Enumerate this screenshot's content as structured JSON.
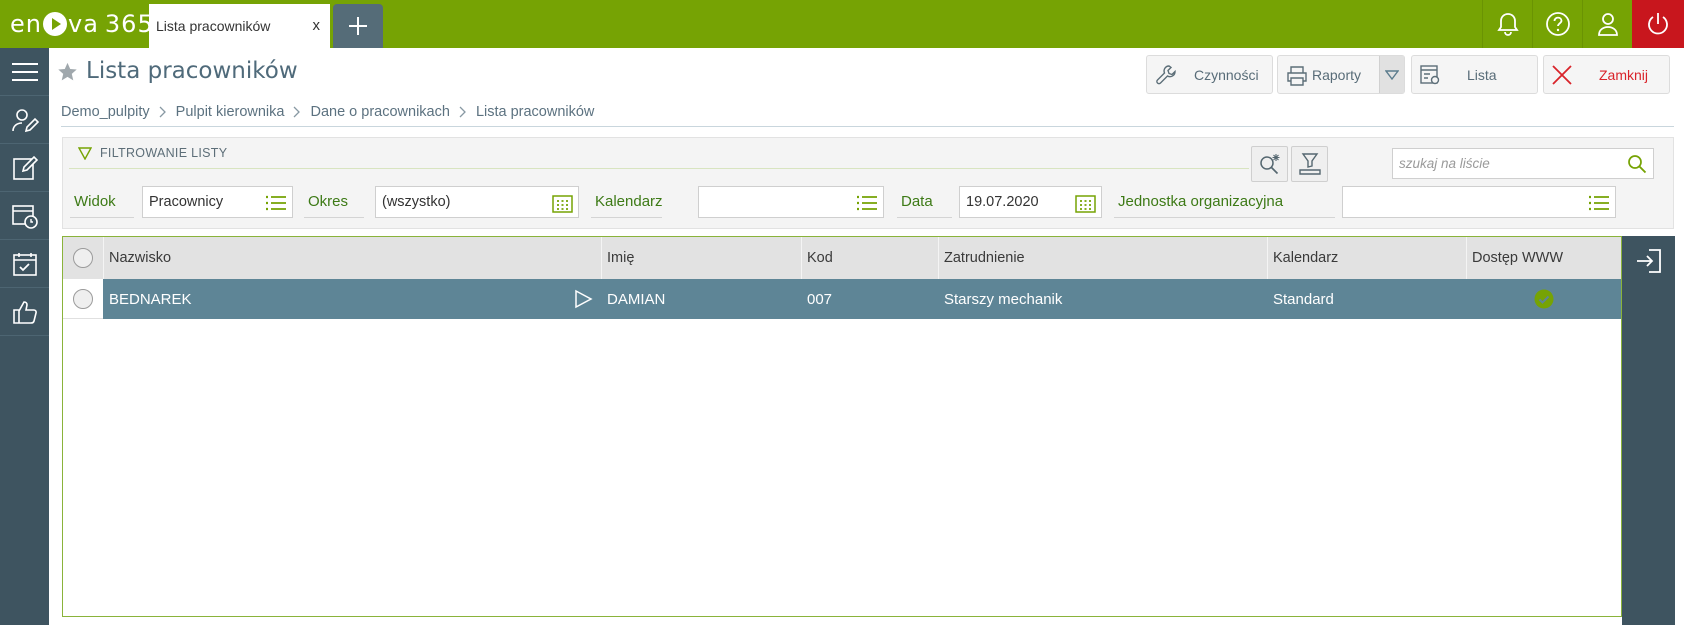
{
  "app": {
    "logo_text_left": "en",
    "logo_text_mid": "va",
    "logo_text_num": "365"
  },
  "tabs": [
    {
      "label": "Lista pracowników",
      "close": "x"
    }
  ],
  "header": {
    "title": "Lista pracowników",
    "buttons": {
      "czynnosci": "Czynności",
      "raporty": "Raporty",
      "lista": "Lista",
      "zamknij": "Zamknij"
    }
  },
  "breadcrumb": [
    "Demo_pulpity",
    "Pulpit kierownika",
    "Dane o pracownikach",
    "Lista pracowników"
  ],
  "filter": {
    "title": "FILTROWANIE LISTY",
    "search_placeholder": "szukaj na liście",
    "fields": {
      "widok_label": "Widok",
      "widok_value": "Pracownicy",
      "okres_label": "Okres",
      "okres_value": "(wszystko)",
      "kalendarz_label": "Kalendarz",
      "kalendarz_value": "",
      "data_label": "Data",
      "data_value": "19.07.2020",
      "jednostka_label": "Jednostka organizacyjna",
      "jednostka_value": ""
    }
  },
  "grid": {
    "columns": [
      "Nazwisko",
      "Imię",
      "Kod",
      "Zatrudnienie",
      "Kalendarz",
      "Dostęp WWW"
    ],
    "rows": [
      {
        "nazwisko": "BEDNAREK",
        "imie": "DAMIAN",
        "kod": "007",
        "zatrudnienie": "Starszy mechanik",
        "kalendarz": "Standard",
        "dostep_www": true
      }
    ]
  },
  "colors": {
    "brand_green": "#76a304",
    "sidebar": "#3e5460",
    "selected_row": "#5e8596",
    "close_red": "#d9232a",
    "label_green": "#3d7a16"
  }
}
